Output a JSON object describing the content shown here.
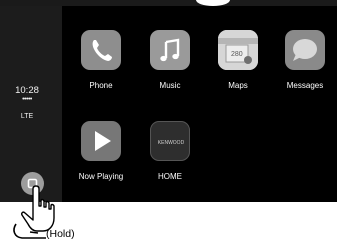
{
  "status": {
    "time": "10:28",
    "signal": "•••••",
    "network": "LTE"
  },
  "apps": [
    {
      "label": "Phone",
      "icon": "phone-icon",
      "color": "#8e8e8e"
    },
    {
      "label": "Music",
      "icon": "music-icon",
      "color": "#9a9a9a"
    },
    {
      "label": "Maps",
      "icon": "maps-icon",
      "color": "#c8c8c8"
    },
    {
      "label": "Messages",
      "icon": "messages-icon",
      "color": "#8a8a8a"
    },
    {
      "label": "Now Playing",
      "icon": "now-playing-icon",
      "color": "#777777"
    },
    {
      "label": "HOME",
      "icon": "kenwood-home-icon",
      "color": "#2e2e2e",
      "icon_text": "KENWOOD"
    }
  ],
  "annotation": {
    "hold_text": "(Hold)"
  }
}
